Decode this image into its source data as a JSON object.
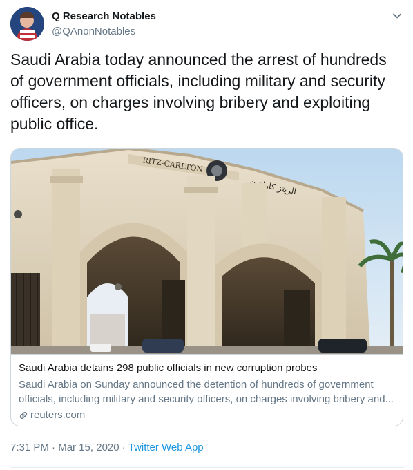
{
  "author": {
    "display_name": "Q Research Notables",
    "handle": "@QAnonNotables",
    "avatar_icon": "avatar-image"
  },
  "tweet": {
    "text": "Saudi Arabia today announced the arrest of hundreds\nof government officials, including military and security\nofficers, on charges involving bribery and exploiting\npublic office."
  },
  "card": {
    "image_signs": {
      "hotel_name": "RITZ-CARLTON",
      "arabic_name": "الريتز كارلتون"
    },
    "title": "Saudi Arabia detains 298 public officials in new corruption probes",
    "description": "Saudi Arabia on Sunday announced the detention of hundreds of government officials, including military and security officers, on charges involving bribery and...",
    "domain": "reuters.com",
    "domain_icon": "link-icon"
  },
  "meta": {
    "time": "7:31 PM",
    "separator": "·",
    "date": "Mar 15, 2020",
    "source": "Twitter Web App"
  },
  "colors": {
    "text_primary": "#14171a",
    "text_secondary": "#657786",
    "link": "#1b95e0",
    "border": "#ccd6dd"
  }
}
